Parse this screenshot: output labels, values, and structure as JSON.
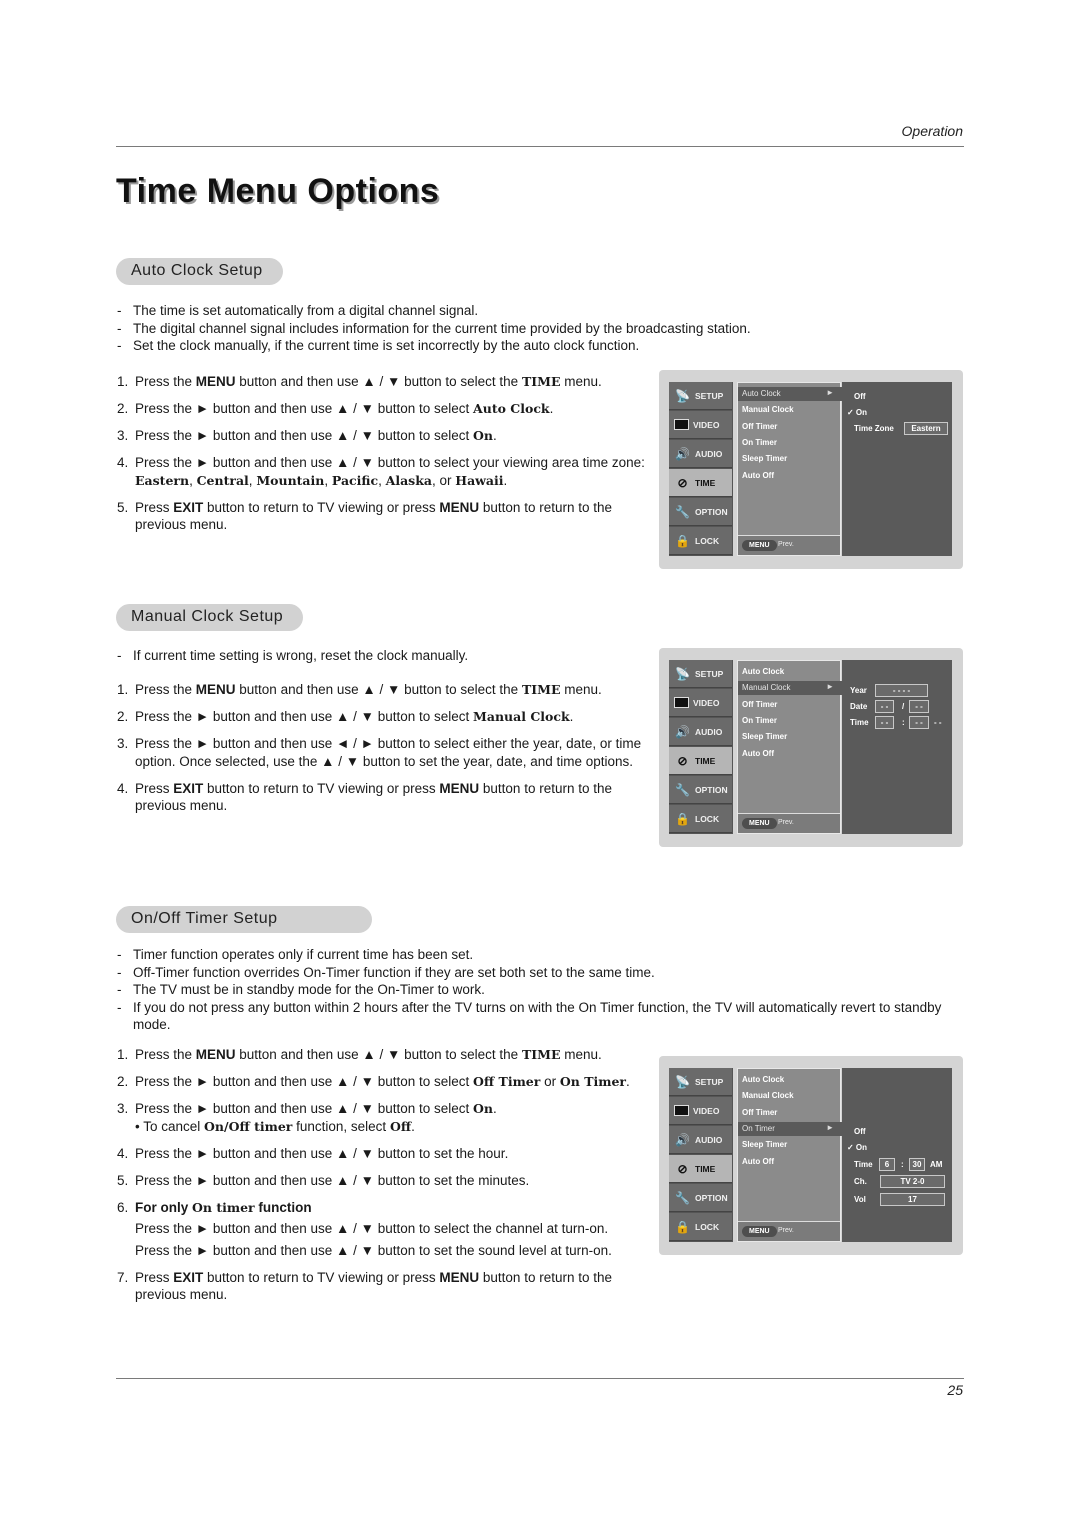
{
  "header": {
    "section": "Operation",
    "page_number": "25"
  },
  "title": "Time Menu Options",
  "auto_clock": {
    "heading": "Auto Clock Setup",
    "bullets": [
      "The time is set automatically from a digital channel signal.",
      "The digital channel signal includes information for the current time provided by the broadcasting station.",
      "Set the clock manually, if the current time is set incorrectly by the auto clock function."
    ],
    "steps": [
      {
        "num": "1.",
        "parts": [
          "Press the ",
          "MENU",
          " button and then use ",
          "▲ / ▼",
          " button to select the ",
          "TIME",
          " menu."
        ]
      },
      {
        "num": "2.",
        "parts": [
          "Press the ",
          "►",
          " button and then use ",
          "▲ / ▼",
          " button to select ",
          "Auto Clock",
          "."
        ]
      },
      {
        "num": "3.",
        "parts": [
          "Press the ",
          "►",
          " button and then use ",
          "▲ / ▼",
          " button to select ",
          "On",
          "."
        ]
      },
      {
        "num": "4.",
        "text": "Press the ► button and then use ▲ / ▼ button to select your viewing area time zone: Eastern, Central, Mountain, Pacific, Alaska, or Hawaii."
      },
      {
        "num": "5.",
        "text": "Press EXIT button to return to TV viewing or press MENU button to return to the previous menu."
      }
    ]
  },
  "manual_clock": {
    "heading": "Manual Clock Setup",
    "bullets": [
      "If current time setting is wrong, reset the clock manually."
    ],
    "steps": [
      {
        "num": "1.",
        "text": "Press the MENU button and then use ▲ / ▼ button to select the TIME menu."
      },
      {
        "num": "2.",
        "text": "Press the ► button and then use ▲ / ▼ button to select Manual Clock."
      },
      {
        "num": "3.",
        "text": "Press the ► button and then use ◄ / ► button to select either the year, date, or time option. Once selected, use the ▲ / ▼ button to set the year, date, and time options."
      },
      {
        "num": "4.",
        "text": "Press EXIT button to return to TV viewing or press MENU button to return to the previous menu."
      }
    ]
  },
  "timer": {
    "heading": "On/Off Timer Setup",
    "bullets": [
      "Timer function operates only if current time has been set.",
      "Off-Timer function overrides On-Timer function if they are set both set to the same time.",
      "The TV must be in standby mode for the On-Timer to work.",
      "If you do not press any button within 2 hours after the TV turns on with the On Timer function, the TV will automatically revert to standby mode."
    ],
    "steps": [
      {
        "num": "1.",
        "text": "Press the MENU button and then use ▲ / ▼ button to select the TIME menu."
      },
      {
        "num": "2.",
        "text": "Press the ► button and then use ▲ / ▼ button to select Off Timer or On Timer."
      },
      {
        "num": "3.",
        "text": "Press the ► button and then use ▲ / ▼ button to select On.",
        "note": "• To cancel On/Off timer function, select Off."
      },
      {
        "num": "4.",
        "text": "Press the ► button and then use ▲ / ▼ button to set the hour."
      },
      {
        "num": "5.",
        "text": "Press the ► button and then use ▲ / ▼ button to set the minutes."
      },
      {
        "num": "6.",
        "text": "For only On timer function",
        "lines": [
          "Press the ► button and then use ▲ / ▼ button to select the channel at turn-on.",
          "Press the ► button and then use ▲ / ▼ button to set the sound level at turn-on."
        ]
      },
      {
        "num": "7.",
        "text": "Press EXIT button to return to TV viewing or press MENU button to return to the previous menu."
      }
    ]
  },
  "tv_menu": {
    "categories": [
      "SETUP",
      "VIDEO",
      "AUDIO",
      "TIME",
      "OPTION",
      "LOCK"
    ],
    "items": [
      "Auto Clock",
      "Manual Clock",
      "Off Timer",
      "On Timer",
      "Sleep Timer",
      "Auto Off"
    ],
    "menu_button": "MENU",
    "prev": "Prev.",
    "auto_clock_panel": {
      "off": "Off",
      "on": "✓ On",
      "time_zone_label": "Time Zone",
      "time_zone": "Eastern"
    },
    "manual_clock_panel": {
      "year_label": "Year",
      "year": "- - - -",
      "date_label": "Date",
      "date_month": "- -",
      "date_sep": "/",
      "date_day": "- -",
      "time_label": "Time",
      "time_hour": "- -",
      "time_sep": ":",
      "time_min": "- -",
      "ampm": "- -"
    },
    "timer_panel": {
      "off": "Off",
      "on": "✓ On",
      "time_label": "Time",
      "hour": "6",
      "sep": ":",
      "minute": "30",
      "ampm": "AM",
      "ch_label": "Ch.",
      "channel": "TV  2-0",
      "vol_label": "Vol",
      "volume": "17"
    }
  }
}
